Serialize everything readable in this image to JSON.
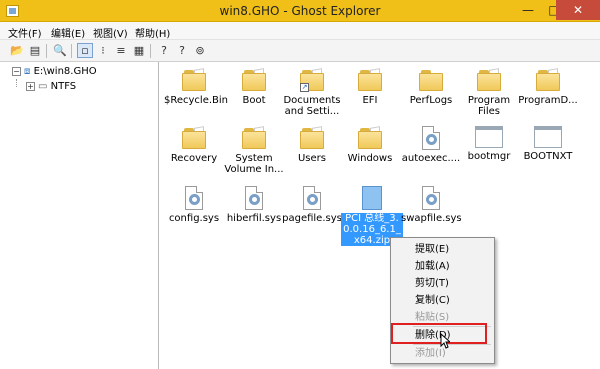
{
  "window": {
    "title": "win8.GHO - Ghost Explorer",
    "min": "—",
    "max": "□",
    "close": "✕"
  },
  "menu": [
    "文件(F)",
    "编辑(E)",
    "视图(V)",
    "帮助(H)"
  ],
  "tree": {
    "root": "E:\\win8.GHO",
    "child": "NTFS"
  },
  "files": [
    {
      "name": "$Recycle.Bin",
      "type": "folder"
    },
    {
      "name": "Boot",
      "type": "folder"
    },
    {
      "name": "Documents and Setti...",
      "type": "folder-shortcut"
    },
    {
      "name": "EFI",
      "type": "folder"
    },
    {
      "name": "PerfLogs",
      "type": "folder"
    },
    {
      "name": "Program Files",
      "type": "folder"
    },
    {
      "name": "ProgramD...",
      "type": "folder"
    },
    {
      "name": "Recovery",
      "type": "folder"
    },
    {
      "name": "System Volume In...",
      "type": "folder"
    },
    {
      "name": "Users",
      "type": "folder"
    },
    {
      "name": "Windows",
      "type": "folder"
    },
    {
      "name": "autoexec....",
      "type": "gear-file"
    },
    {
      "name": "bootmgr",
      "type": "blank"
    },
    {
      "name": "BOOTNXT",
      "type": "blank"
    },
    {
      "name": "config.sys",
      "type": "gear-file"
    },
    {
      "name": "hiberfil.sys",
      "type": "gear-file"
    },
    {
      "name": "pagefile.sys",
      "type": "gear-file"
    },
    {
      "name": "PCI 总线_3.0.0.16_6.1_x64.zip",
      "type": "zip"
    },
    {
      "name": "swapfile.sys",
      "type": "gear-file"
    }
  ],
  "context_menu": [
    {
      "label": "提取(E)",
      "enabled": true
    },
    {
      "label": "加载(A)",
      "enabled": true
    },
    {
      "label": "剪切(T)",
      "enabled": true
    },
    {
      "label": "复制(C)",
      "enabled": true
    },
    {
      "label": "粘贴(S)",
      "enabled": false
    },
    {
      "label": "删除(D)",
      "enabled": true
    },
    {
      "label": "添加(I)",
      "enabled": false
    }
  ],
  "colors": {
    "titlebar": "#f0c018",
    "selection": "#3399ff",
    "highlight_box": "#e02020"
  }
}
